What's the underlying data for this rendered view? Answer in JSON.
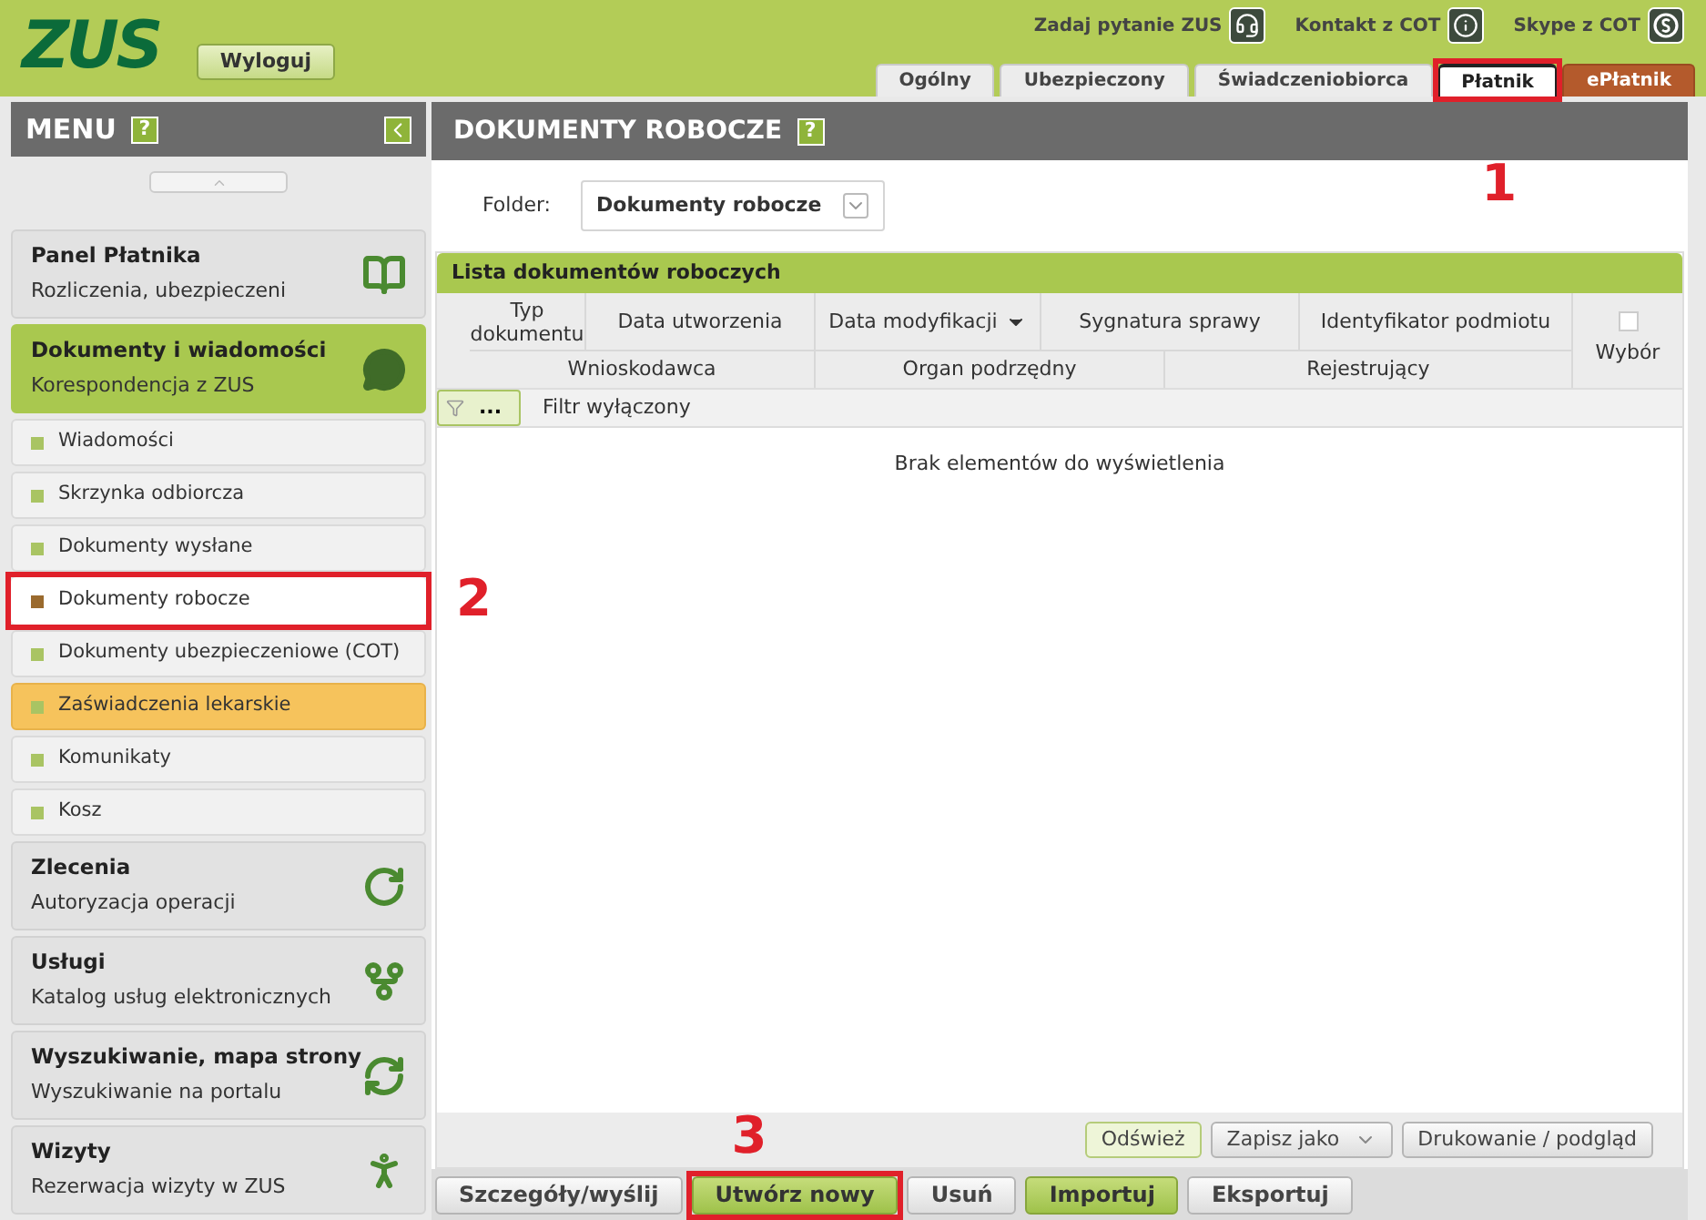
{
  "header": {
    "logo": "ZUS",
    "logout": "Wyloguj",
    "links": [
      {
        "label": "Zadaj pytanie ZUS"
      },
      {
        "label": "Kontakt z COT"
      },
      {
        "label": "Skype z COT"
      }
    ],
    "tabs": [
      {
        "label": "Ogólny",
        "selected": false,
        "kind": "normal"
      },
      {
        "label": "Ubezpieczony",
        "selected": false,
        "kind": "normal"
      },
      {
        "label": "Świadczeniobiorca",
        "selected": false,
        "kind": "normal"
      },
      {
        "label": "Płatnik",
        "selected": true,
        "kind": "normal",
        "annotation": "1"
      },
      {
        "label": "ePłatnik",
        "selected": false,
        "kind": "accent"
      }
    ]
  },
  "menu": {
    "title": "MENU",
    "help": "?",
    "groups": [
      {
        "title": "Panel Płatnika",
        "subtitle": "Rozliczenia, ubezpieczeni",
        "selected": false
      },
      {
        "title": "Dokumenty i wiadomości",
        "subtitle": "Korespondencja z ZUS",
        "selected": true,
        "children": [
          {
            "label": "Wiadomości",
            "selected": false,
            "flagged": false
          },
          {
            "label": "Skrzynka odbiorcza",
            "selected": false,
            "flagged": false
          },
          {
            "label": "Dokumenty wysłane",
            "selected": false,
            "flagged": false
          },
          {
            "label": "Dokumenty robocze",
            "selected": true,
            "flagged": false,
            "annotation": "2"
          },
          {
            "label": "Dokumenty ubezpieczeniowe (COT)",
            "selected": false,
            "flagged": false
          },
          {
            "label": "Zaświadczenia lekarskie",
            "selected": false,
            "flagged": true
          },
          {
            "label": "Komunikaty",
            "selected": false,
            "flagged": false
          },
          {
            "label": "Kosz",
            "selected": false,
            "flagged": false
          }
        ]
      },
      {
        "title": "Zlecenia",
        "subtitle": "Autoryzacja operacji",
        "selected": false
      },
      {
        "title": "Usługi",
        "subtitle": "Katalog usług elektronicznych",
        "selected": false
      },
      {
        "title": "Wyszukiwanie, mapa strony",
        "subtitle": "Wyszukiwanie na portalu",
        "selected": false
      },
      {
        "title": "Wizyty",
        "subtitle": "Rezerwacja wizyty w ZUS",
        "selected": false
      }
    ]
  },
  "main": {
    "title": "DOKUMENTY ROBOCZE",
    "help": "?",
    "folder": {
      "label": "Folder:",
      "value": "Dokumenty robocze"
    },
    "grid": {
      "title": "Lista dokumentów roboczych",
      "columns_row1": [
        {
          "label": "Typ dokumentu",
          "sorted": false
        },
        {
          "label": "Data utworzenia",
          "sorted": false
        },
        {
          "label": "Data modyfikacji",
          "sorted": true
        },
        {
          "label": "Sygnatura sprawy",
          "sorted": false
        },
        {
          "label": "Identyfikator podmiotu",
          "sorted": false
        }
      ],
      "columns_row2": [
        {
          "label": "Wnioskodawca"
        },
        {
          "label": "Organ podrzędny"
        },
        {
          "label": "Rejestrujący"
        }
      ],
      "select_all": {
        "label": "Wybór",
        "checked": false
      },
      "filter": {
        "button": "...",
        "label": "Filtr wyłączony"
      },
      "empty": "Brak elementów do wyświetlenia"
    },
    "grid_buttons": [
      {
        "label": "Odśwież",
        "kind": "primary"
      },
      {
        "label": "Zapisz jako",
        "kind": "split"
      },
      {
        "label": "Drukowanie / podgląd",
        "kind": "default"
      }
    ],
    "actions": [
      {
        "label": "Szczegóły/wyślij",
        "kind": "default"
      },
      {
        "label": "Utwórz nowy",
        "kind": "primary",
        "annotation": "3"
      },
      {
        "label": "Usuń",
        "kind": "default"
      },
      {
        "label": "Importuj",
        "kind": "primary"
      },
      {
        "label": "Eksportuj",
        "kind": "default"
      }
    ]
  }
}
